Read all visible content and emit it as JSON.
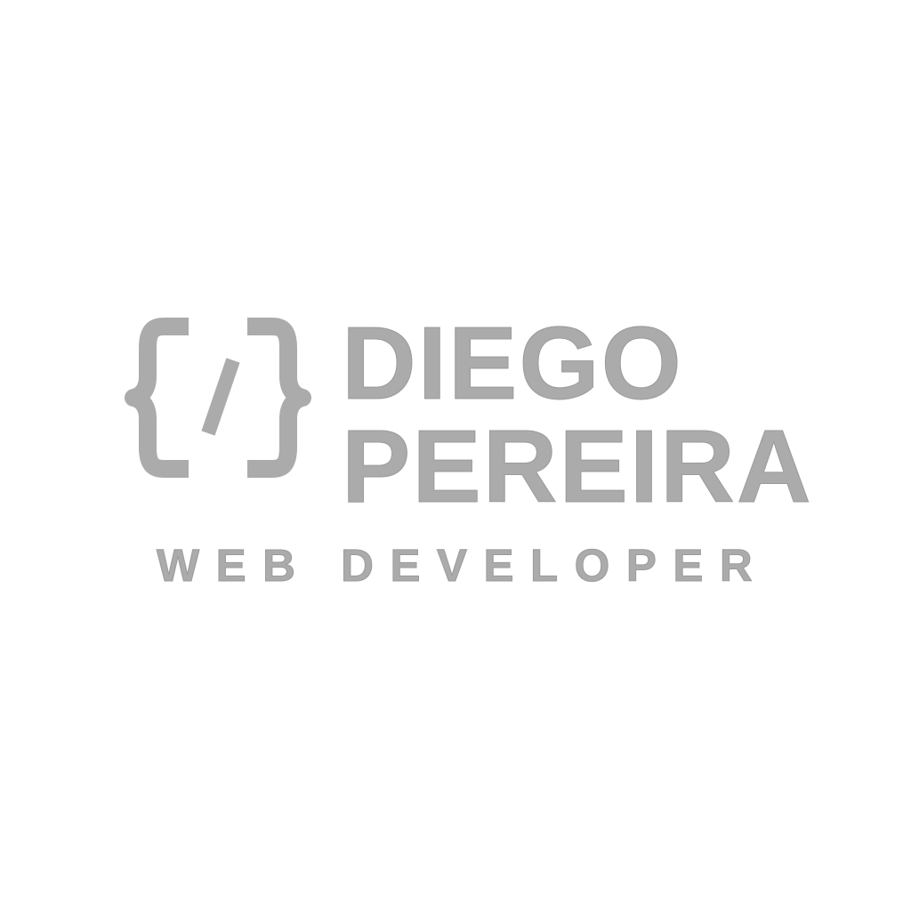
{
  "brand": {
    "first_name": "DIEGO",
    "last_name": "PEREIRA",
    "tagline": "WEB DEVELOPER",
    "logo_icon": "code-brackets-slash-icon"
  },
  "colors": {
    "background": "#ffffff",
    "text_fill": "#ababab",
    "text_outline": "#9a9a9a"
  }
}
